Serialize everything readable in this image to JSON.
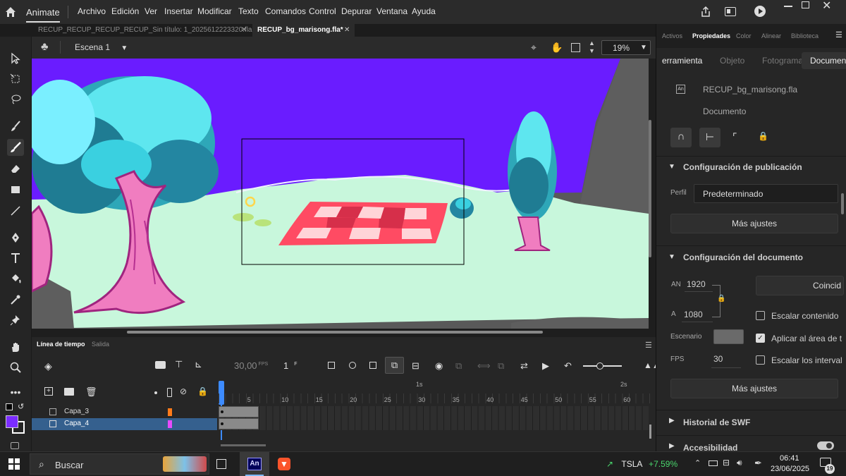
{
  "app": {
    "name": "Animate"
  },
  "menu": [
    "Archivo",
    "Edición",
    "Ver",
    "Insertar",
    "Modificar",
    "Texto",
    "Comandos",
    "Control",
    "Depurar",
    "Ventana",
    "Ayuda"
  ],
  "documents": [
    {
      "label": "RECUP_RECUP_RECUP_RECUP_Sin título: 1_2025612223320.fla",
      "active": false
    },
    {
      "label": "RECUP_bg_marisong.fla*",
      "active": true
    }
  ],
  "scene": {
    "label": "Escena 1",
    "zoom": "19%"
  },
  "panel": {
    "top_tabs": [
      "Activos",
      "Propiedades",
      "Color",
      "Alinear",
      "Biblioteca"
    ],
    "sub_tabs": [
      "erramienta",
      "Objeto",
      "Fotograma",
      "Documen"
    ],
    "file_name": "RECUP_bg_marisong.fla",
    "file_type": "Documento",
    "publish_section": "Configuración de publicación",
    "profile_label": "Perfil",
    "profile_value": "Predeterminado",
    "more_settings": "Más ajustes",
    "doc_section": "Configuración del documento",
    "width_label": "AN",
    "width_value": "1920",
    "height_label": "A",
    "height_value": "1080",
    "match_button": "Coincid",
    "scale_content": "Escalar contenido",
    "stage_label": "Escenario",
    "stage_color": "#6a6a6a",
    "apply_label": "Aplicar al área de t",
    "fps_label": "FPS",
    "fps_value": "30",
    "scale_intervals": "Escalar los interval",
    "more_settings_2": "Más ajustes",
    "swf_history": "Historial de SWF",
    "accessibility": "Accesibilidad"
  },
  "timeline": {
    "tabs": [
      "Línea de tiempo",
      "Salida"
    ],
    "fps": "30,00",
    "fps_unit": "FPS",
    "frame": "1",
    "frame_unit": "F",
    "second_markers": [
      "1s",
      "2s"
    ],
    "frame_numbers": [
      "1",
      "5",
      "10",
      "15",
      "20",
      "25",
      "30",
      "35",
      "40",
      "45",
      "50",
      "55",
      "60"
    ],
    "layers": [
      {
        "name": "Capa_3",
        "color": "#ff7b1a",
        "selected": false
      },
      {
        "name": "Capa_4",
        "color": "#e64bff",
        "selected": true
      }
    ]
  },
  "colors": {
    "fill": "#7b2cff",
    "stroke": "#ffffff",
    "stage_sky": "#6a1cff",
    "stage_grass": "#c8f7dc"
  },
  "taskbar": {
    "search_placeholder": "Buscar",
    "stock_ticker": "TSLA",
    "stock_change": "+7.59%",
    "time": "06:41",
    "date": "23/06/2025",
    "notifications": "19"
  }
}
